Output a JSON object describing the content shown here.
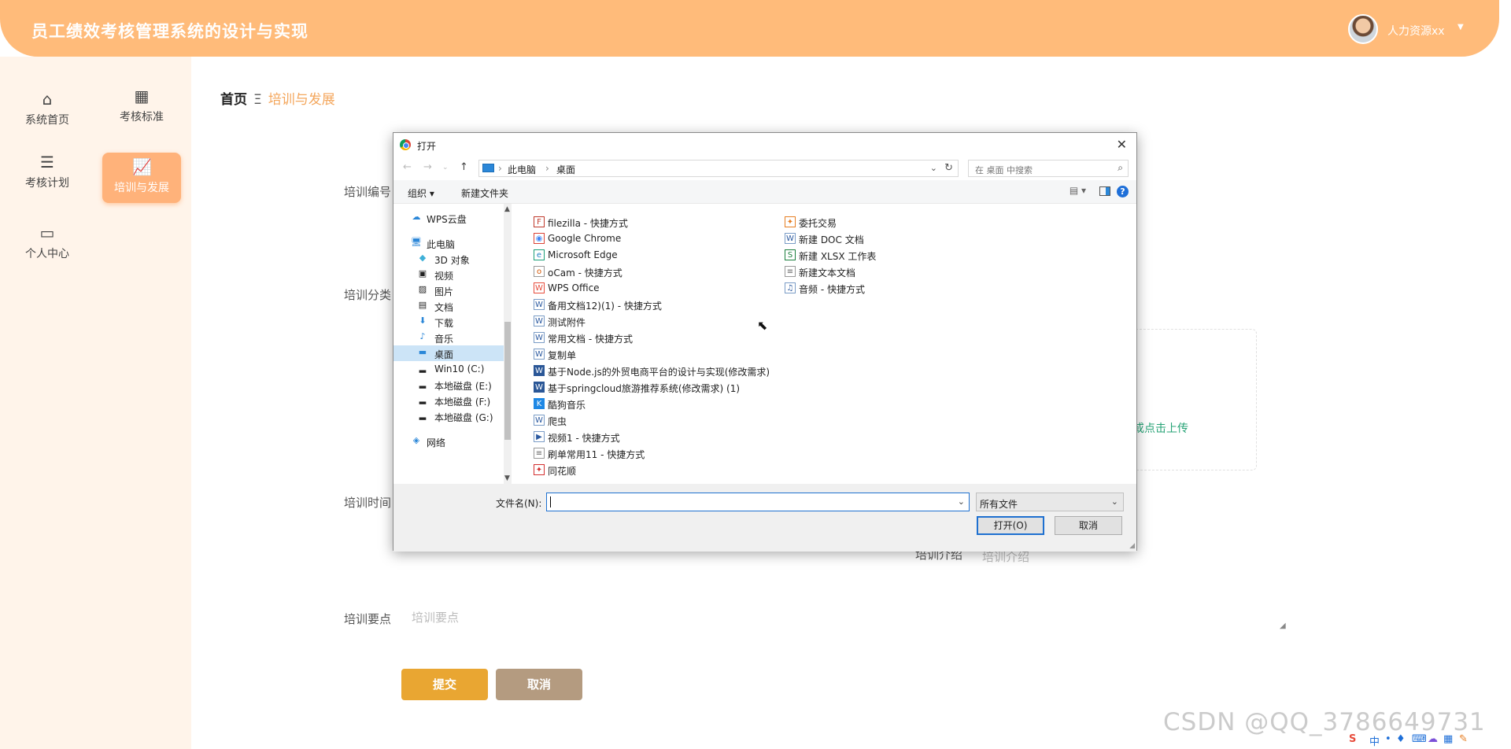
{
  "header": {
    "title": "员工绩效考核管理系统的设计与实现",
    "user": "人力资源xx",
    "caret": "▼"
  },
  "sidebar": {
    "items": [
      {
        "label": "系统首页",
        "icon": "home-icon",
        "glyph": "⌂"
      },
      {
        "label": "考核标准",
        "icon": "grid-icon",
        "glyph": "▦"
      },
      {
        "label": "考核计划",
        "icon": "list-icon",
        "glyph": "☰"
      },
      {
        "label": "培训与发展",
        "icon": "chart-icon",
        "glyph": "📈"
      },
      {
        "label": "个人中心",
        "icon": "card-icon",
        "glyph": "▭"
      }
    ]
  },
  "breadcrumb": {
    "home": "首页",
    "sep": "Ξ",
    "current": "培训与发展"
  },
  "form": {
    "labels": {
      "code": "培训编号",
      "category": "培训分类",
      "time": "培训时间",
      "intro": "培训介绍",
      "points": "培训要点"
    },
    "intro_placeholder": "培训介绍",
    "points_placeholder": "培训要点",
    "upload_text": "或点击上传",
    "submit": "提交",
    "cancel": "取消"
  },
  "dialog": {
    "title": "打开",
    "close": "✕",
    "address": {
      "pc": "此电脑",
      "arrow": "›",
      "folder": "桌面"
    },
    "search_placeholder": "在 桌面 中搜索",
    "toolbar": {
      "organize": "组织 ▾",
      "new_folder": "新建文件夹",
      "help": "?",
      "view": "▤ ▾"
    },
    "tree": [
      {
        "label": "WPS云盘",
        "glyph": "☁",
        "color": "#2b87d8"
      },
      {
        "label": "此电脑",
        "glyph": "🖥",
        "color": "#2b87d8"
      },
      {
        "label": "3D 对象",
        "glyph": "◆",
        "color": "#3fb0d8"
      },
      {
        "label": "视频",
        "glyph": "▣",
        "color": "#555"
      },
      {
        "label": "图片",
        "glyph": "▨",
        "color": "#555"
      },
      {
        "label": "文档",
        "glyph": "▤",
        "color": "#555"
      },
      {
        "label": "下载",
        "glyph": "⬇",
        "color": "#2b87d8"
      },
      {
        "label": "音乐",
        "glyph": "♪",
        "color": "#2b87d8"
      },
      {
        "label": "桌面",
        "glyph": "▬",
        "color": "#2b87d8"
      },
      {
        "label": "Win10 (C:)",
        "glyph": "▂",
        "color": "#555"
      },
      {
        "label": "本地磁盘 (E:)",
        "glyph": "▂",
        "color": "#555"
      },
      {
        "label": "本地磁盘 (F:)",
        "glyph": "▂",
        "color": "#555"
      },
      {
        "label": "本地磁盘 (G:)",
        "glyph": "▂",
        "color": "#555"
      },
      {
        "label": "网络",
        "glyph": "◈",
        "color": "#2b87d8"
      }
    ],
    "files_col1": [
      {
        "label": "filezilla - 快捷方式",
        "glyph": "F"
      },
      {
        "label": "Google Chrome",
        "glyph": "◉"
      },
      {
        "label": "Microsoft Edge",
        "glyph": "e"
      },
      {
        "label": "oCam - 快捷方式",
        "glyph": "o"
      },
      {
        "label": "WPS Office",
        "glyph": "W"
      },
      {
        "label": "备用文档12)(1) - 快捷方式",
        "glyph": "W"
      },
      {
        "label": "测试附件",
        "glyph": "W"
      },
      {
        "label": "常用文档 - 快捷方式",
        "glyph": "W"
      },
      {
        "label": "复制单",
        "glyph": "W"
      },
      {
        "label": "基于Node.js的外贸电商平台的设计与实现(修改需求)",
        "glyph": "W"
      },
      {
        "label": "基于springcloud旅游推荐系统(修改需求) (1)",
        "glyph": "W"
      },
      {
        "label": "酷狗音乐",
        "glyph": "K"
      },
      {
        "label": "爬虫",
        "glyph": "W"
      },
      {
        "label": "视频1 - 快捷方式",
        "glyph": "▶"
      },
      {
        "label": "刷单常用11 - 快捷方式",
        "glyph": "≡"
      },
      {
        "label": "同花顺",
        "glyph": "✦"
      }
    ],
    "files_col2": [
      {
        "label": "委托交易",
        "glyph": "✦"
      },
      {
        "label": "新建 DOC 文档",
        "glyph": "W"
      },
      {
        "label": "新建 XLSX 工作表",
        "glyph": "S"
      },
      {
        "label": "新建文本文档",
        "glyph": "≡"
      },
      {
        "label": "音频 - 快捷方式",
        "glyph": "♫"
      }
    ],
    "filename_label": "文件名(N):",
    "filetype": "所有文件",
    "open": "打开(O)",
    "cancel": "取消"
  },
  "watermark": "CSDN @QQ_3786649731",
  "tray": {
    "ime": "中",
    "items": [
      "S",
      "•",
      "♦",
      "⌨",
      "☁",
      "▦",
      "✎"
    ]
  }
}
